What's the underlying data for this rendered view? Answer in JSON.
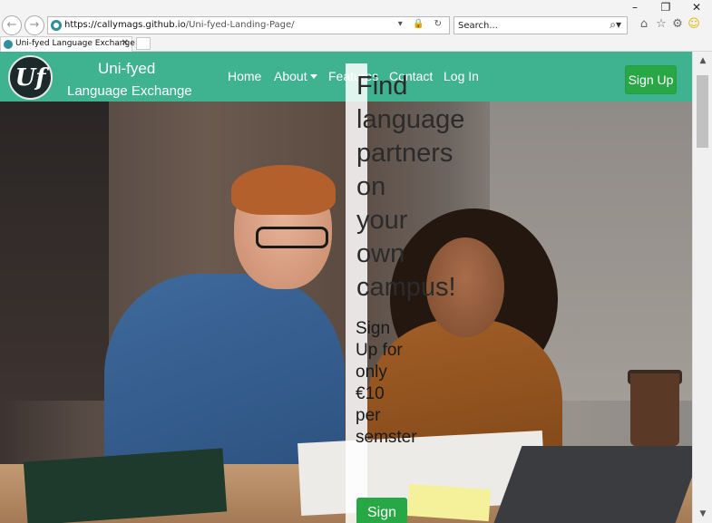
{
  "browser": {
    "url_host": "https://callymags.github.io",
    "url_path": "/Uni-fyed-Landing-Page/",
    "search_placeholder": "Search...",
    "tab_title": "Uni-fyed Language Exchange",
    "window_controls": [
      "–",
      "❐",
      "✕"
    ]
  },
  "navbar": {
    "logo_text": "Uf",
    "brand_name": "Uni-fyed",
    "brand_subtitle": "Language Exchange",
    "links": [
      {
        "label": "Home"
      },
      {
        "label": "About"
      },
      {
        "label": "Features"
      },
      {
        "label": "Contact"
      },
      {
        "label": "Log In"
      }
    ],
    "signup_label": "Sign Up",
    "accent_color": "#3fb28f",
    "button_color": "#28a745"
  },
  "hero": {
    "headline": "Find language partners on your own campus!",
    "subheadline": "Sign Up for only €10 per semster",
    "cta_label": "Sign Up"
  }
}
